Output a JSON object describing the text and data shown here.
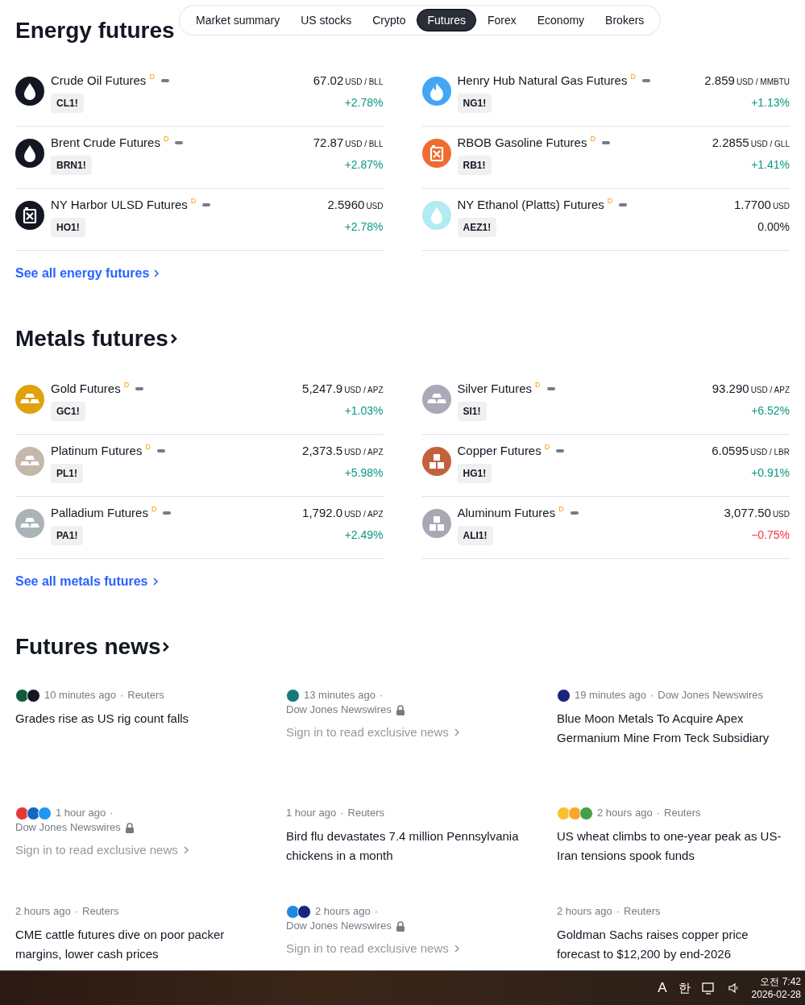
{
  "nav": {
    "tabs": [
      {
        "label": "Market summary",
        "selected": false
      },
      {
        "label": "US stocks",
        "selected": false
      },
      {
        "label": "Crypto",
        "selected": false
      },
      {
        "label": "Futures",
        "selected": true
      },
      {
        "label": "Forex",
        "selected": false
      },
      {
        "label": "Economy",
        "selected": false
      },
      {
        "label": "Brokers",
        "selected": false
      }
    ]
  },
  "sections": [
    {
      "title": "Energy futures",
      "title_chevron": false,
      "see_all": "See all energy futures",
      "items": [
        {
          "name": "Crude Oil Futures",
          "delayed": "D",
          "ticker": "CL1!",
          "price": "67.02",
          "unit": "USD / BLL",
          "change": "+2.78%",
          "rising": true,
          "falling": false,
          "kind": "drop",
          "color": "#131722"
        },
        {
          "name": "Henry Hub Natural Gas Futures",
          "delayed": "D",
          "ticker": "NG1!",
          "price": "2.859",
          "unit": "USD / MMBTU",
          "change": "+1.13%",
          "rising": true,
          "falling": false,
          "kind": "flame",
          "color": "#42a5f5"
        },
        {
          "name": "Brent Crude Futures",
          "delayed": "D",
          "ticker": "BRN1!",
          "price": "72.87",
          "unit": "USD / BLL",
          "change": "+2.87%",
          "rising": true,
          "falling": false,
          "kind": "drop",
          "color": "#131722"
        },
        {
          "name": "RBOB Gasoline Futures",
          "delayed": "D",
          "ticker": "RB1!",
          "price": "2.2855",
          "unit": "USD / GLL",
          "change": "+1.41%",
          "rising": true,
          "falling": false,
          "kind": "canister",
          "color": "#ef6c2f"
        },
        {
          "name": "NY Harbor ULSD Futures",
          "delayed": "D",
          "ticker": "HO1!",
          "price": "2.5960",
          "unit": "USD",
          "change": "+2.78%",
          "rising": true,
          "falling": false,
          "kind": "canister",
          "color": "#131722"
        },
        {
          "name": "NY Ethanol (Platts) Futures",
          "delayed": "D",
          "ticker": "AEZ1!",
          "price": "1.7700",
          "unit": "USD",
          "change": "0.00%",
          "rising": false,
          "falling": false,
          "kind": "drop",
          "color": "#b2ebf2"
        }
      ]
    },
    {
      "title": "Metals futures",
      "title_chevron": true,
      "see_all": "See all metals futures",
      "items": [
        {
          "name": "Gold Futures",
          "delayed": "D",
          "ticker": "GC1!",
          "price": "5,247.9",
          "unit": "USD / APZ",
          "change": "+1.03%",
          "rising": true,
          "falling": false,
          "kind": "bars",
          "color": "#dfa20b"
        },
        {
          "name": "Silver Futures",
          "delayed": "D",
          "ticker": "SI1!",
          "price": "93.290",
          "unit": "USD / APZ",
          "change": "+6.52%",
          "rising": true,
          "falling": false,
          "kind": "bars",
          "color": "#a9a9b8"
        },
        {
          "name": "Platinum Futures",
          "delayed": "D",
          "ticker": "PL1!",
          "price": "2,373.5",
          "unit": "USD / APZ",
          "change": "+5.98%",
          "rising": true,
          "falling": false,
          "kind": "bars",
          "color": "#c4b8ab"
        },
        {
          "name": "Copper Futures",
          "delayed": "D",
          "ticker": "HG1!",
          "price": "6.0595",
          "unit": "USD / LBR",
          "change": "+0.91%",
          "rising": true,
          "falling": false,
          "kind": "cubes",
          "color": "#c2623d"
        },
        {
          "name": "Palladium Futures",
          "delayed": "D",
          "ticker": "PA1!",
          "price": "1,792.0",
          "unit": "USD / APZ",
          "change": "+2.49%",
          "rising": true,
          "falling": false,
          "kind": "bars",
          "color": "#aab4b6"
        },
        {
          "name": "Aluminum Futures",
          "delayed": "D",
          "ticker": "ALI1!",
          "price": "3,077.50",
          "unit": "USD",
          "change": "−0.75%",
          "rising": false,
          "falling": true,
          "kind": "cubes",
          "color": "#a8a8b5"
        }
      ]
    }
  ],
  "news": {
    "title": "Futures news",
    "separator": "·",
    "items": [
      {
        "logos": [
          {
            "color": "#0b5d3b"
          },
          {
            "color": "#131722"
          }
        ],
        "time": "10 minutes ago",
        "source": "Reuters",
        "locked": false,
        "headline": "Grades rise as US rig count falls"
      },
      {
        "logos": [
          {
            "color": "#17787a"
          }
        ],
        "time": "13 minutes ago",
        "source": "Dow Jones Newswires",
        "locked": true,
        "headline": "Sign in to read exclusive news"
      },
      {
        "logos": [
          {
            "color": "#1a237e"
          }
        ],
        "time": "19 minutes ago",
        "source": "Dow Jones Newswires",
        "locked": false,
        "headline": "Blue Moon Metals To Acquire Apex Germanium Mine From Teck Subsidiary"
      },
      {
        "logos": [
          {
            "color": "#e53935"
          },
          {
            "color": "#1565c0"
          },
          {
            "color": "#2196f3"
          }
        ],
        "time": "1 hour ago",
        "source": "Dow Jones Newswires",
        "locked": true,
        "headline": "Sign in to read exclusive news"
      },
      {
        "time": "1 hour ago",
        "source": "Reuters",
        "locked": false,
        "headline": "Bird flu devastates 7.4 million Pennsylvania chickens in a month"
      },
      {
        "logos": [
          {
            "color": "#fbc02d"
          },
          {
            "color": "#f9a825"
          },
          {
            "color": "#43a047"
          }
        ],
        "time": "2 hours ago",
        "source": "Reuters",
        "locked": false,
        "headline": "US wheat climbs to one-year peak as US-Iran tensions spook funds"
      },
      {
        "time": "2 hours ago",
        "source": "Reuters",
        "locked": false,
        "headline": "CME cattle futures dive on poor packer margins, lower cash prices"
      },
      {
        "logos": [
          {
            "color": "#1e88e5"
          },
          {
            "color": "#1a237e"
          }
        ],
        "time": "2 hours ago",
        "source": "Dow Jones Newswires",
        "locked": true,
        "headline": "Sign in to read exclusive news"
      },
      {
        "time": "2 hours ago",
        "source": "Reuters",
        "locked": false,
        "headline": "Goldman Sachs raises copper price forecast to $12,200 by end-2026"
      }
    ]
  },
  "taskbar": {
    "input_mode": "A",
    "ime": "한",
    "time": "오전 7:42",
    "date": "2026-02-28"
  }
}
